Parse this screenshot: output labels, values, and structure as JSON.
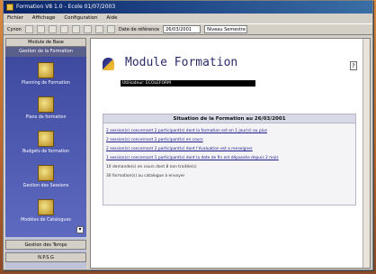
{
  "window": {
    "title": "Formation V8 1.0 - Ecole 01/07/2003"
  },
  "menu": [
    "Fichier",
    "Affichage",
    "Configuration",
    "Aide"
  ],
  "toolbar": {
    "login_label": "Cynon",
    "date_label": "Date de référence",
    "date_value": "26/03/2001",
    "select_value": "Niveau Semestre"
  },
  "sidebar": {
    "header": "Module de Base",
    "section": "Gestion de la Formation",
    "items": [
      {
        "label": "Planning de Formation"
      },
      {
        "label": "Plans de formation"
      },
      {
        "label": "Budgets de formation"
      },
      {
        "label": "Gestion des Sessions"
      },
      {
        "label": "Modèles de Catalogues"
      }
    ],
    "footer_1": "Gestion des Temps",
    "footer_2": "N.P.S.G"
  },
  "main": {
    "title": "Module Formation",
    "user_banner": "Utilisateur: ECOLEFORM",
    "help_icon": "?",
    "panel": {
      "title": "Situation de la Formation au 26/03/2001",
      "lines": [
        {
          "text": "2 session(s) concernant 2 participant(s) dont la formation est en 1 jour(s) ou plus",
          "link": true
        },
        {
          "text": "2 session(s) concernant 2 participant(s) en cours",
          "link": true
        },
        {
          "text": "2 session(s) concernant 2 participant(s) dont l'évaluation est a renseigner",
          "link": true
        },
        {
          "text": "1 session(s) concernant 1 participant(s) dont la date de fin est dépassée depuis 2 mois",
          "link": true
        },
        {
          "text": "10 demande(s) en cours dont 8 non traitée(s)",
          "link": false
        },
        {
          "text": "30 formation(s) au catalogue à envoyer",
          "link": false
        }
      ]
    }
  },
  "colors": {
    "title_bar": "#0a246a",
    "sidebar_bg": "#3d4aa0",
    "panel_title_bg": "#d7d9e6",
    "link": "#1a1a8a"
  }
}
